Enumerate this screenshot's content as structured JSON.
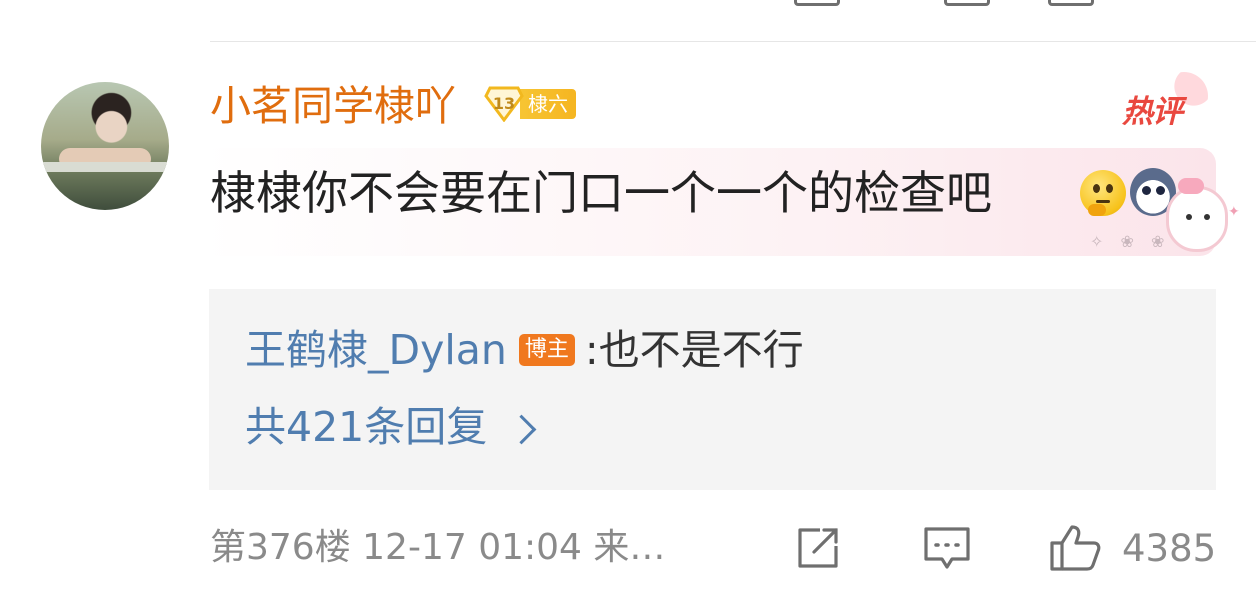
{
  "comment": {
    "username": "小茗同学棣吖",
    "level_number": "13",
    "level_title": "棣六",
    "hot_badge": "热评",
    "text": "棣棣你不会要在门口一个一个的检查吧",
    "reply_preview": {
      "author": "王鹤棣_Dylan",
      "author_badge": "博主",
      "separator": ":",
      "text": "也不是不行",
      "total_replies": "共421条回复"
    },
    "meta": "第376楼 12-17 01:04 来…",
    "like_count": "4385"
  },
  "icons": {
    "share": "share-icon",
    "comment": "comment-icon",
    "like": "thumbs-up-icon"
  },
  "colors": {
    "username": "#e06d0e",
    "link": "#507daf",
    "hot": "#e9483f",
    "blogger_badge": "#f0781e",
    "meta": "#8a8a8a"
  }
}
